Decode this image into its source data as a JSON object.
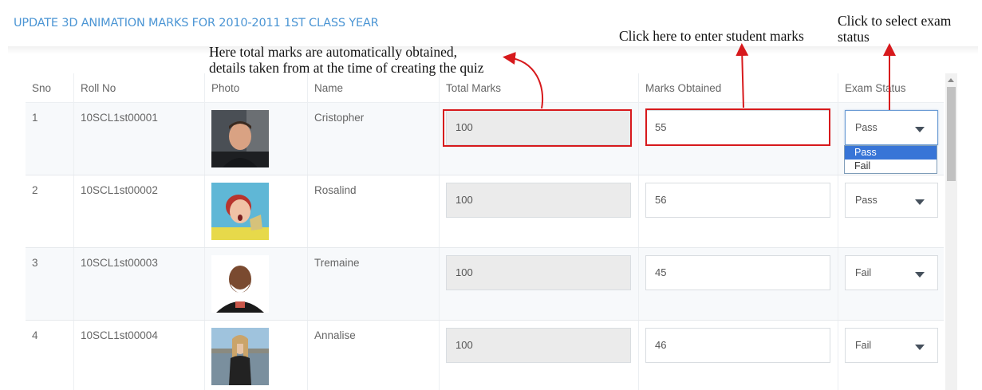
{
  "page": {
    "title": "UPDATE 3D ANIMATION MARKS FOR 2010-2011 1ST CLASS YEAR"
  },
  "annotations": {
    "total_note_line1": "Here total marks are automatically obtained,",
    "total_note_line2": "details taken from at the time of creating the quiz",
    "marks_note": "Click here to enter student marks",
    "status_note_line1": "Click to select exam",
    "status_note_line2": "status",
    "annotation_color": "#d7191c"
  },
  "table": {
    "headers": [
      "Sno",
      "Roll No",
      "Photo",
      "Name",
      "Total Marks",
      "Marks Obtained",
      "Exam Status"
    ],
    "rows": [
      {
        "sno": "1",
        "roll": "10SCL1st00001",
        "name": "Cristopher",
        "total": "100",
        "marks": "55",
        "status": "Pass"
      },
      {
        "sno": "2",
        "roll": "10SCL1st00002",
        "name": "Rosalind",
        "total": "100",
        "marks": "56",
        "status": "Pass"
      },
      {
        "sno": "3",
        "roll": "10SCL1st00003",
        "name": "Tremaine",
        "total": "100",
        "marks": "45",
        "status": "Fail"
      },
      {
        "sno": "4",
        "roll": "10SCL1st00004",
        "name": "Annalise",
        "total": "100",
        "marks": "46",
        "status": "Fail"
      }
    ]
  },
  "status_dropdown": {
    "options": [
      "Pass",
      "Fail"
    ],
    "highlighted": "Pass"
  },
  "colors": {
    "title": "#4b95d4",
    "dropdown_highlight": "#3875d7"
  }
}
